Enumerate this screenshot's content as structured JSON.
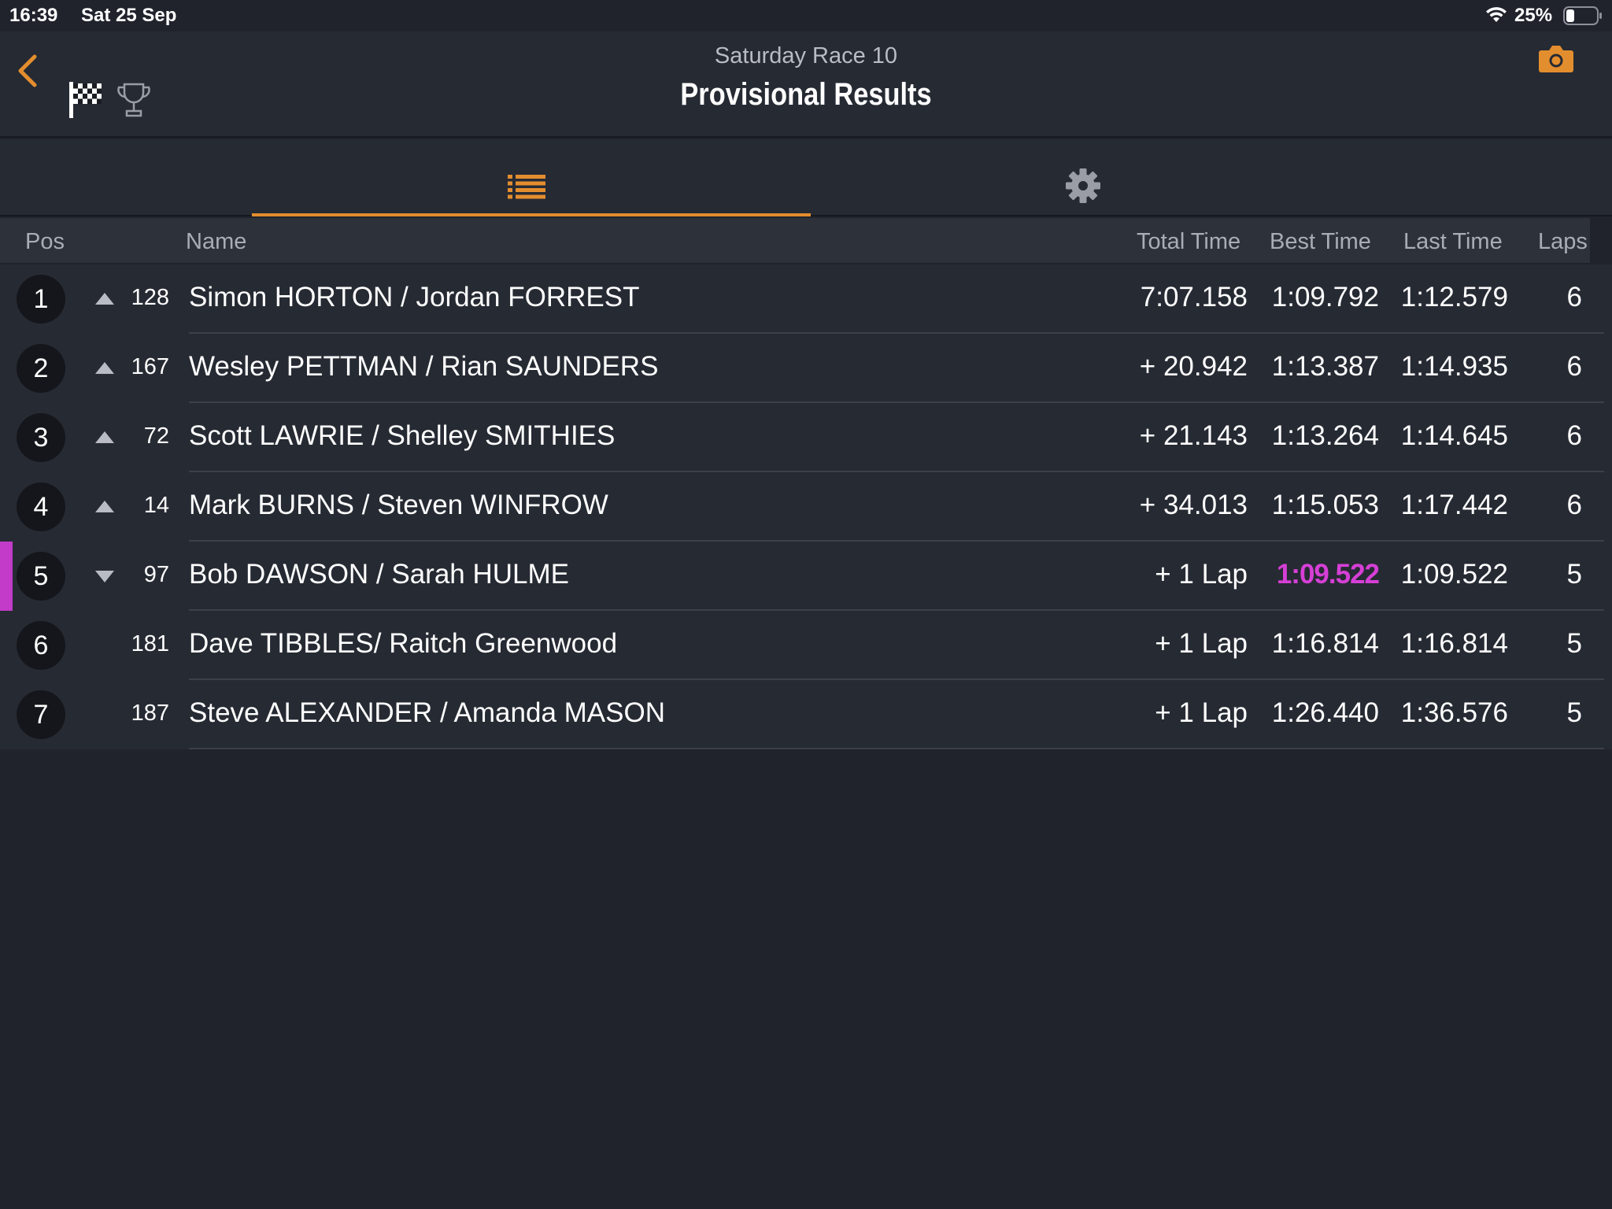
{
  "status_bar": {
    "time": "16:39",
    "date": "Sat 25 Sep",
    "battery": "25%"
  },
  "header": {
    "subtitle": "Saturday Race  10",
    "title": "Provisional Results",
    "accent_color": "#e38e2e"
  },
  "tabs": [
    {
      "icon": "list-icon",
      "selected": true
    },
    {
      "icon": "gear-icon",
      "selected": false
    }
  ],
  "table": {
    "columns": {
      "pos": "Pos",
      "name": "Name",
      "total": "Total Time",
      "best": "Best Time",
      "last": "Last Time",
      "laps": "Laps"
    },
    "rows": [
      {
        "pos": "1",
        "trend": "up",
        "num": "128",
        "name": "Simon HORTON / Jordan FORREST",
        "total": "7:07.158",
        "best": "1:09.792",
        "last": "1:12.579",
        "laps": "6"
      },
      {
        "pos": "2",
        "trend": "up",
        "num": "167",
        "name": "Wesley PETTMAN / Rian SAUNDERS",
        "total": "+ 20.942",
        "best": "1:13.387",
        "last": "1:14.935",
        "laps": "6"
      },
      {
        "pos": "3",
        "trend": "up",
        "num": "72",
        "name": "Scott LAWRIE / Shelley SMITHIES",
        "total": "+ 21.143",
        "best": "1:13.264",
        "last": "1:14.645",
        "laps": "6"
      },
      {
        "pos": "4",
        "trend": "up",
        "num": "14",
        "name": "Mark BURNS / Steven WINFROW",
        "total": "+ 34.013",
        "best": "1:15.053",
        "last": "1:17.442",
        "laps": "6"
      },
      {
        "pos": "5",
        "trend": "down",
        "num": "97",
        "name": "Bob DAWSON / Sarah HULME",
        "total": "+ 1 Lap",
        "best": "1:09.522",
        "last": "1:09.522",
        "laps": "5",
        "fastest": true
      },
      {
        "pos": "6",
        "trend": "none",
        "num": "181",
        "name": "Dave TIBBLES/ Raitch Greenwood",
        "total": "+ 1 Lap",
        "best": "1:16.814",
        "last": "1:16.814",
        "laps": "5"
      },
      {
        "pos": "7",
        "trend": "none",
        "num": "187",
        "name": "Steve ALEXANDER / Amanda MASON",
        "total": "+ 1 Lap",
        "best": "1:26.440",
        "last": "1:36.576",
        "laps": "5"
      }
    ],
    "fastest_color": "#d63fd6"
  }
}
